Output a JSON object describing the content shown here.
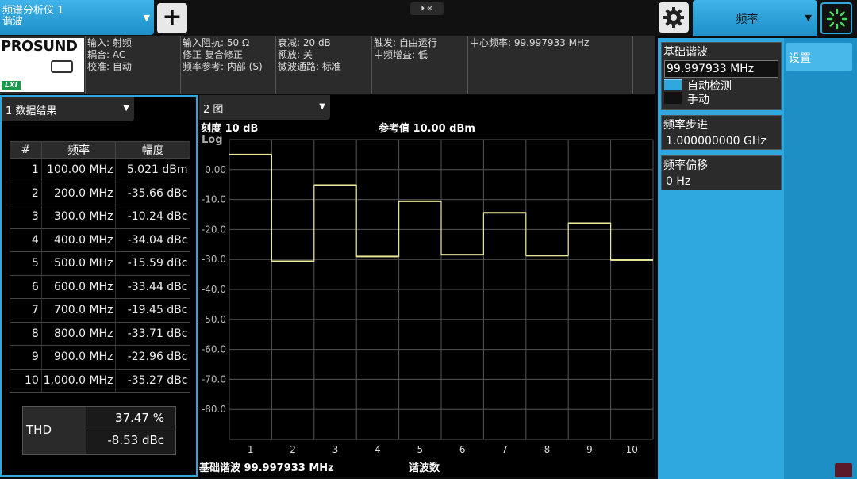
{
  "topbar": {
    "mode_tab_line1": "频谱分析仪 1",
    "mode_tab_line2": "谐波",
    "add_button": "+",
    "mini_control": "⏵ ⊗",
    "freq_menu_label": "频率"
  },
  "logo": {
    "brand": "PROSUND",
    "lxi": "LXI"
  },
  "info": {
    "col1": [
      "输入: 射频",
      "耦合: AC",
      "校准: 自动"
    ],
    "col2": [
      "输入阻抗: 50 Ω",
      "修正 复合修正",
      "频率参考: 内部 (S)"
    ],
    "col3": [
      "衰减: 20 dB",
      "预放: 关",
      "微波通路: 标准"
    ],
    "col4": [
      "触发: 自由运行",
      "中频增益: 低"
    ],
    "col5": [
      "中心频率: 99.997933 MHz"
    ]
  },
  "results_dropdown": "1 数据结果",
  "results_table": {
    "headers": [
      "#",
      "频率",
      "幅度"
    ],
    "rows": [
      [
        "1",
        "100.00 MHz",
        "5.021 dBm"
      ],
      [
        "2",
        "200.0 MHz",
        "-35.66 dBc"
      ],
      [
        "3",
        "300.0 MHz",
        "-10.24 dBc"
      ],
      [
        "4",
        "400.0 MHz",
        "-34.04 dBc"
      ],
      [
        "5",
        "500.0 MHz",
        "-15.59 dBc"
      ],
      [
        "6",
        "600.0 MHz",
        "-33.44 dBc"
      ],
      [
        "7",
        "700.0 MHz",
        "-19.45 dBc"
      ],
      [
        "8",
        "800.0 MHz",
        "-33.71 dBc"
      ],
      [
        "9",
        "900.0 MHz",
        "-22.96 dBc"
      ],
      [
        "10",
        "1,000.0 MHz",
        "-35.27 dBc"
      ]
    ]
  },
  "thd": {
    "label": "THD",
    "percent": "37.47 %",
    "dbc": "-8.53 dBc"
  },
  "chart_dropdown": "2 图",
  "chart_header": {
    "scale": "刻度 10 dB",
    "log": "Log",
    "ref": "参考值 10.00 dBm"
  },
  "chart_footer": {
    "fundamental": "基础谐波 99.997933 MHz",
    "xlabel": "谐波数"
  },
  "chart_data": {
    "type": "bar",
    "categories": [
      "1",
      "2",
      "3",
      "4",
      "5",
      "6",
      "7",
      "8",
      "9",
      "10"
    ],
    "values": [
      5.0,
      -30.6,
      -5.2,
      -29.0,
      -10.6,
      -28.4,
      -14.4,
      -28.7,
      -17.9,
      -30.2
    ],
    "ylim": [
      -90,
      10
    ],
    "yticks": [
      "0.00",
      "-10.0",
      "-20.0",
      "-30.0",
      "-40.0",
      "-50.0",
      "-60.0",
      "-70.0",
      "-80.0"
    ],
    "grid": true,
    "trace_color": "#e8e89a"
  },
  "right_panel": {
    "setting_tab": "设置",
    "fundamental": {
      "title": "基础谐波",
      "value": "99.997933 MHz",
      "auto": "自动检测",
      "manual": "手动"
    },
    "step": {
      "title": "频率步进",
      "value": "1.000000000 GHz"
    },
    "offset": {
      "title": "频率偏移",
      "value": "0 Hz"
    }
  },
  "colors": {
    "accent": "#2fa8e0",
    "trace": "#e8e89a",
    "lxi": "#1c9b4a"
  }
}
